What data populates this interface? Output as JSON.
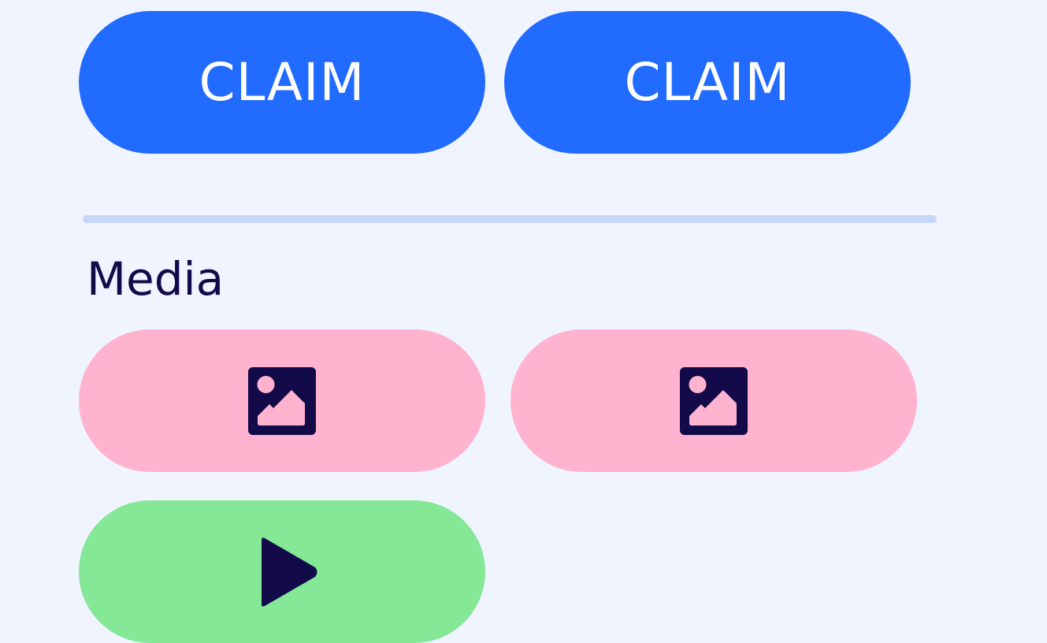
{
  "colors": {
    "background": "#EFF4FF",
    "claim_button": "#216BFF",
    "claim_text": "#FFFFFF",
    "divider": "#C5D7F8",
    "heading": "#130A4A",
    "image_button": "#FFB3CF",
    "video_button": "#84E896",
    "icon": "#130A4A"
  },
  "actions": {
    "claim_buttons": [
      {
        "label": "CLAIM"
      },
      {
        "label": "CLAIM"
      }
    ]
  },
  "media": {
    "title": "Media",
    "buttons": [
      {
        "kind": "image",
        "icon": "image-icon"
      },
      {
        "kind": "image",
        "icon": "image-icon"
      },
      {
        "kind": "video",
        "icon": "play-icon"
      }
    ]
  }
}
